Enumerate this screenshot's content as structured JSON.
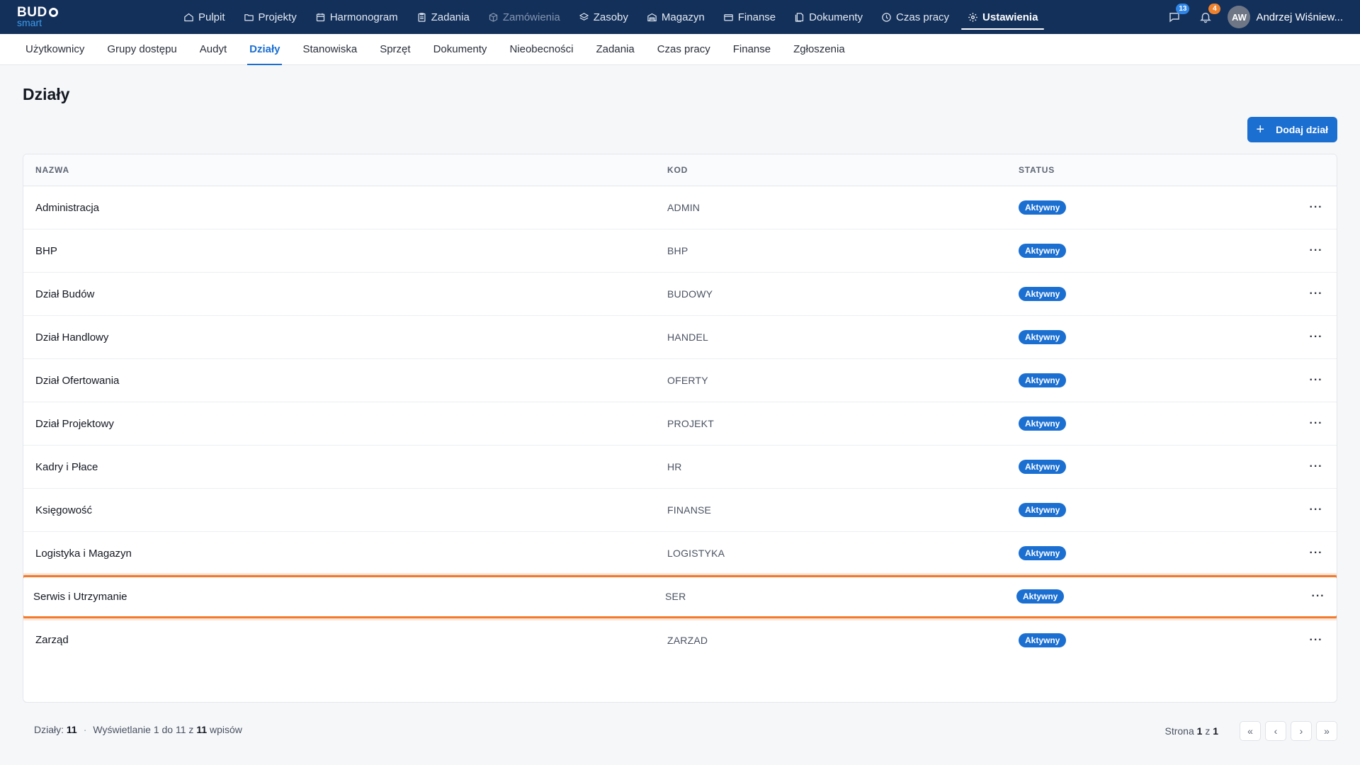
{
  "app": {
    "logo_main": "BUD",
    "logo_sub": "smart"
  },
  "nav": {
    "items": [
      {
        "label": "Pulpit",
        "icon": "home-icon"
      },
      {
        "label": "Projekty",
        "icon": "folder-icon"
      },
      {
        "label": "Harmonogram",
        "icon": "calendar-icon"
      },
      {
        "label": "Zadania",
        "icon": "clipboard-icon"
      },
      {
        "label": "Zamówienia",
        "icon": "box-icon",
        "disabled": true
      },
      {
        "label": "Zasoby",
        "icon": "layers-icon"
      },
      {
        "label": "Magazyn",
        "icon": "warehouse-icon"
      },
      {
        "label": "Finanse",
        "icon": "card-icon"
      },
      {
        "label": "Dokumenty",
        "icon": "documents-icon"
      },
      {
        "label": "Czas pracy",
        "icon": "clock-icon"
      },
      {
        "label": "Ustawienia",
        "icon": "gear-icon",
        "active": true
      }
    ],
    "messages_count": "13",
    "notifications_count": "4",
    "user_initials": "AW",
    "user_name": "Andrzej Wiśniew..."
  },
  "subnav": {
    "items": [
      "Użytkownicy",
      "Grupy dostępu",
      "Audyt",
      "Działy",
      "Stanowiska",
      "Sprzęt",
      "Dokumenty",
      "Nieobecności",
      "Zadania",
      "Czas pracy",
      "Finanse",
      "Zgłoszenia"
    ],
    "active": "Działy"
  },
  "page": {
    "title": "Działy",
    "add_button": "Dodaj dział"
  },
  "table": {
    "headers": {
      "name": "NAZWA",
      "code": "KOD",
      "status": "STATUS"
    },
    "rows": [
      {
        "name": "Administracja",
        "code": "ADMIN",
        "status": "Aktywny"
      },
      {
        "name": "BHP",
        "code": "BHP",
        "status": "Aktywny"
      },
      {
        "name": "Dział Budów",
        "code": "BUDOWY",
        "status": "Aktywny"
      },
      {
        "name": "Dział Handlowy",
        "code": "HANDEL",
        "status": "Aktywny"
      },
      {
        "name": "Dział Ofertowania",
        "code": "OFERTY",
        "status": "Aktywny"
      },
      {
        "name": "Dział Projektowy",
        "code": "PROJEKT",
        "status": "Aktywny"
      },
      {
        "name": "Kadry i Płace",
        "code": "HR",
        "status": "Aktywny"
      },
      {
        "name": "Księgowość",
        "code": "FINANSE",
        "status": "Aktywny"
      },
      {
        "name": "Logistyka i Magazyn",
        "code": "LOGISTYKA",
        "status": "Aktywny"
      },
      {
        "name": "Serwis i Utrzymanie",
        "code": "SER",
        "status": "Aktywny",
        "highlighted": true
      },
      {
        "name": "Zarząd",
        "code": "ZARZAD",
        "status": "Aktywny"
      }
    ]
  },
  "footer": {
    "count_label": "Działy:",
    "count_value": "11",
    "showing_prefix": "Wyświetlanie 1 do 11 z",
    "showing_total": "11",
    "showing_suffix": "wpisów",
    "page_prefix": "Strona",
    "page_current": "1",
    "page_of": "z",
    "page_total": "1"
  },
  "colors": {
    "topbar": "#13305a",
    "accent": "#1b6fd1",
    "highlight": "#f37a2d",
    "badge_blue": "#2f86e8",
    "badge_orange": "#f0822d"
  }
}
